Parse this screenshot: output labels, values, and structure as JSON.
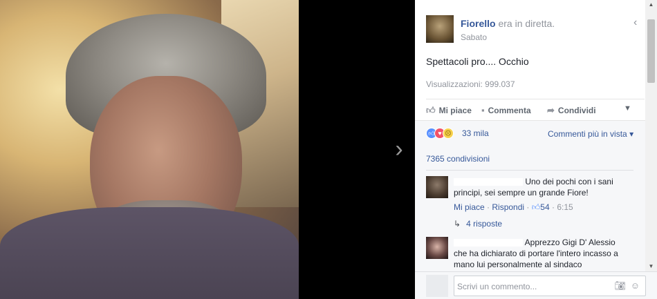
{
  "post": {
    "author": "Fiorello",
    "verb": "era in diretta.",
    "date": "Sabato",
    "text": "Spettacoli pro.... Occhio",
    "views": "Visualizzazioni: 999.037"
  },
  "actions": {
    "like": "Mi piace",
    "comment": "Commenta",
    "share": "Condividi"
  },
  "reactions": {
    "count": "33 mila",
    "sort": "Commenti più in vista",
    "shares": "7365 condivisioni"
  },
  "comments": [
    {
      "text": "Uno dei pochi con i sani principi, sei sempre un grande Fiore!",
      "like": "Mi piace",
      "reply": "Rispondi",
      "likes": "54",
      "time": "6:15",
      "replies": "4 risposte"
    },
    {
      "text": "Apprezzo Gigi D' Alessio che ha dichiarato di portare l'intero incasso a mano lui personalmente al sindaco"
    }
  ],
  "compose": {
    "placeholder": "Scrivi un commento..."
  },
  "icons": {
    "next": "chevron-right-icon",
    "collapse": "chevron-left-icon",
    "like": "thumbs-up-icon",
    "comment": "comment-icon",
    "share": "share-arrow-icon",
    "camera": "camera-icon",
    "emoji": "smiley-icon"
  },
  "colors": {
    "link": "#365899",
    "muted": "#90949c",
    "like_blue": "#5890ff",
    "love_red": "#f25268"
  }
}
